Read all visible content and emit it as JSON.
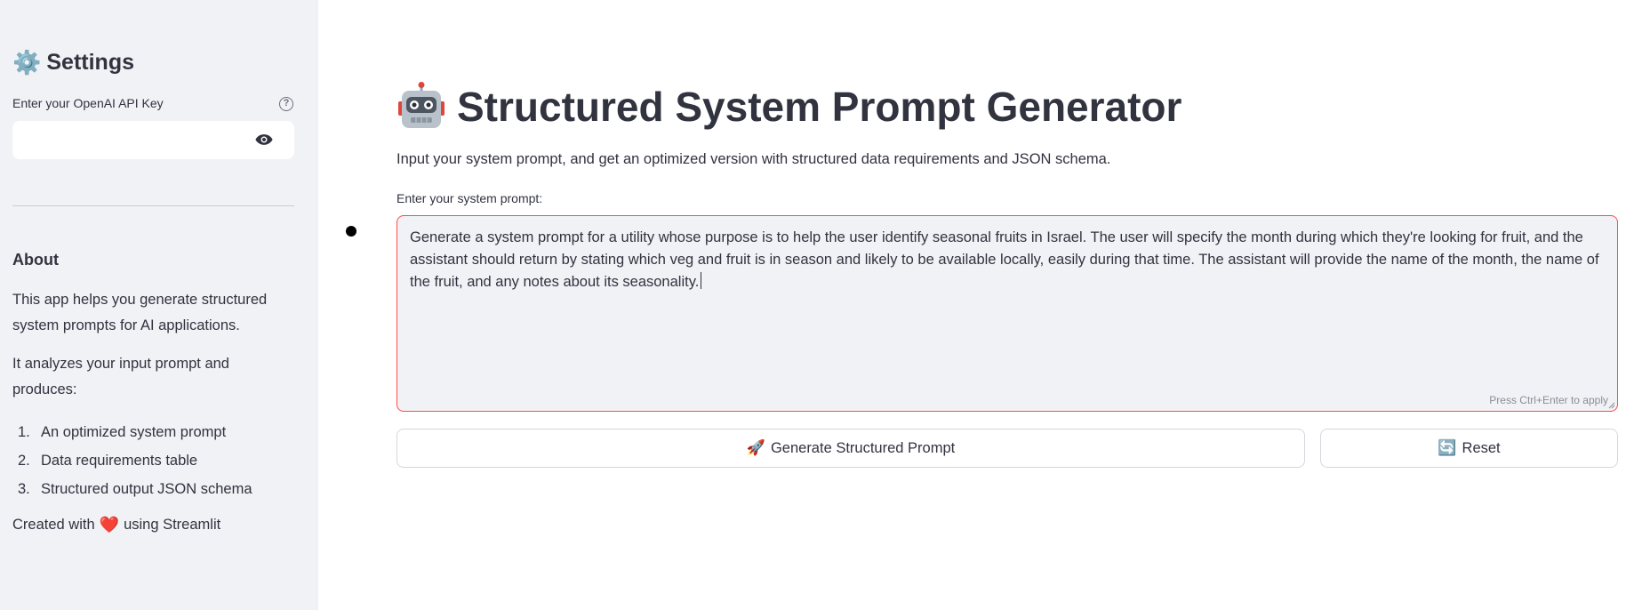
{
  "sidebar": {
    "title": "Settings",
    "title_icon": "gear-icon",
    "api_key_label": "Enter your OpenAI API Key",
    "api_key_value": "",
    "help_glyph": "?",
    "about": {
      "heading": "About",
      "paragraph1": "This app helps you generate structured system prompts for AI applications.",
      "paragraph2": "It analyzes your input prompt and produces:",
      "list": [
        {
          "num": "1.",
          "text": "An optimized system prompt"
        },
        {
          "num": "2.",
          "text": "Data requirements table"
        },
        {
          "num": "3.",
          "text": "Structured output JSON schema"
        }
      ],
      "created_prefix": "Created with",
      "created_suffix": "using Streamlit"
    }
  },
  "main": {
    "title": "Structured System Prompt Generator",
    "title_icon": "robot-icon",
    "subtitle": "Input your system prompt, and get an optimized version with structured data requirements and JSON schema.",
    "prompt_label": "Enter your system prompt:",
    "prompt_value": "Generate a system prompt for a utility whose purpose is to help the user identify seasonal fruits in Israel. The user will specify the month during which they're looking for fruit, and the assistant should return by stating which veg and fruit is in season and likely to be available locally, easily during that time. The assistant will provide the name of the month, the name of the fruit, and any notes about its seasonality.",
    "prompt_hint": "Press Ctrl+Enter to apply",
    "generate_button": "Generate Structured Prompt",
    "reset_button": "Reset"
  },
  "colors": {
    "sidebar_bg": "#f0f2f6",
    "text": "#31333f",
    "focus_border": "#ff4b4b"
  }
}
